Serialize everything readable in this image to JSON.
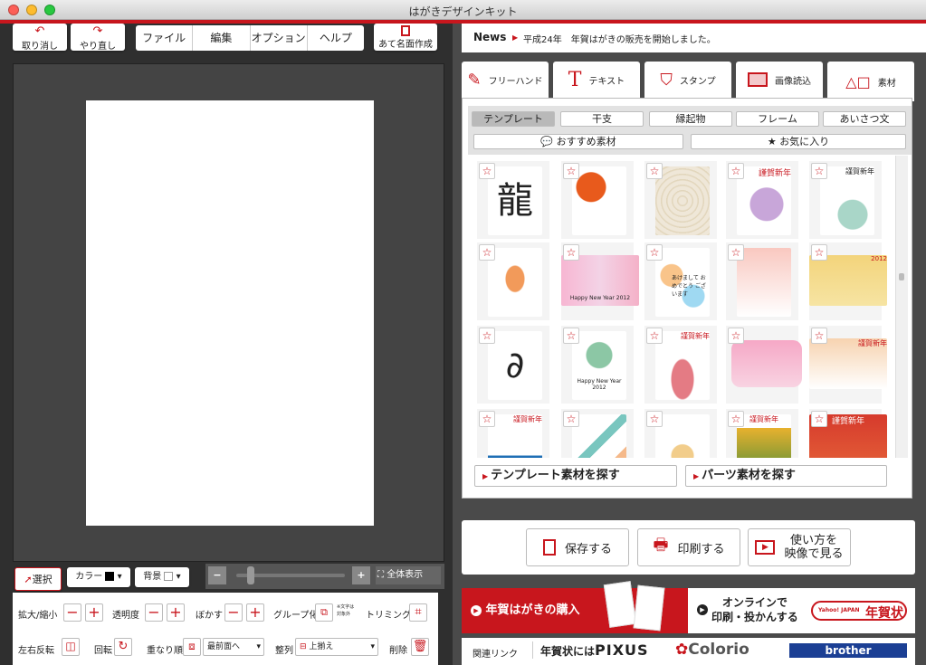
{
  "window": {
    "title": "はがきデザインキット"
  },
  "toolbar": {
    "undo": "取り消し",
    "redo": "やり直し",
    "address": "あて名面作成",
    "menus": [
      "ファイル",
      "編集",
      "オプション",
      "ヘルプ"
    ]
  },
  "news": {
    "label": "News",
    "text": "平成24年　年賀はがきの販売を開始しました。"
  },
  "tabs": [
    {
      "label": "フリーハンド",
      "icon": "pen-icon"
    },
    {
      "label": "テキスト",
      "icon": "text-icon"
    },
    {
      "label": "スタンプ",
      "icon": "stamp-icon"
    },
    {
      "label": "画像読込",
      "icon": "image-import-icon"
    },
    {
      "label": "素材",
      "icon": "shapes-icon"
    }
  ],
  "categories": [
    "テンプレート",
    "干支",
    "縁起物",
    "フレーム",
    "あいさつ文"
  ],
  "filters": {
    "recommended": "おすすめ素材",
    "favorites": "お気に入り"
  },
  "search": {
    "template": "テンプレート素材を探す",
    "parts": "パーツ素材を探す"
  },
  "actions": {
    "save": "保存する",
    "print": "印刷する",
    "video_line1": "使い方を",
    "video_line2": "映像で見る"
  },
  "banner": {
    "buy": "年賀はがきの購入",
    "online_line1": "オンラインで",
    "online_line2": "印刷・投かんする",
    "yahoo_small": "Yahoo! JAPAN",
    "yahoo_big": "年賀状"
  },
  "links": {
    "label": "関連リンク",
    "pixus_pre": "年賀状には",
    "pixus": "PIXUS",
    "colorio": "Colorio",
    "brother": "brother"
  },
  "zoom": {
    "fit": "全体表示",
    "minus": "−",
    "plus": "+"
  },
  "tools": {
    "select": "選択",
    "color": "カラー",
    "background": "背景",
    "scale": "拡大/縮小",
    "opacity": "透明度",
    "blur": "ぼかす",
    "group": "グループ化",
    "group_note1": "※文字は",
    "group_note2": "対象外",
    "trim": "トリミング",
    "flip": "左右反転",
    "rotate": "回転",
    "order": "重なり順",
    "order_value": "最前面へ",
    "align": "整列",
    "align_value": "上揃え",
    "delete": "削除"
  },
  "thumbnail_text": {
    "t1": "龍",
    "t2": "謹賀新年",
    "t3": "Happy New Year 2012",
    "t4": "あけまして おめでとう ございます",
    "t5": "2012"
  },
  "colors": {
    "brand_red": "#c8161d",
    "bg_dark": "#2f2f2f"
  }
}
